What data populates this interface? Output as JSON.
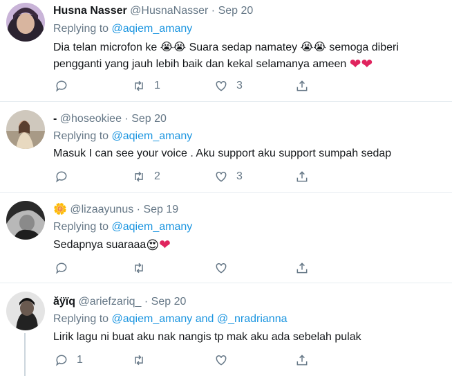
{
  "tweets": [
    {
      "name": "Husna Nasser",
      "handle": "@HusnaNasser",
      "date": "Sep 20",
      "reply_prefix": "Replying to",
      "reply_to": "@aqiem_amany",
      "text_line1": "Dia telan microfon ke 😭😭 Suara sedap namatey 😭😭 semoga diberi",
      "text_line2": "pengganti yang jauh lebih baik dan kekal selamanya ameen",
      "hearts": "❤❤",
      "replies": "",
      "retweets": "1",
      "likes": "3"
    },
    {
      "name": "-",
      "handle": "@hoseokiee",
      "date": "Sep 20",
      "reply_prefix": "Replying to",
      "reply_to": "@aqiem_amany",
      "text_line1": "Masuk I can see your voice . Aku support aku support sumpah sedap",
      "replies": "",
      "retweets": "2",
      "likes": "3"
    },
    {
      "name": "🌼",
      "handle": "@lizaayunus",
      "date": "Sep 19",
      "reply_prefix": "Replying to",
      "reply_to": "@aqiem_amany",
      "text_line1": "Sedapnya suaraaa",
      "emoji": "😍",
      "hearts": "❤",
      "replies": "",
      "retweets": "",
      "likes": ""
    },
    {
      "name": "ǎÿïq",
      "handle": "@ariefzariq_",
      "date": "Sep 20",
      "reply_prefix": "Replying to",
      "reply_to": "@aqiem_amany",
      "reply_and": "and",
      "reply_to2": "@_nradrianna",
      "text_line1": "Lirik lagu ni buat aku nak nangis tp mak aku ada sebelah pulak",
      "replies": "1",
      "retweets": "",
      "likes": ""
    }
  ],
  "separator": "·",
  "icons": [
    "reply-icon",
    "retweet-icon",
    "like-icon",
    "share-icon"
  ],
  "colors": {
    "link": "#1b95e0",
    "muted": "#657786",
    "heart": "#e0245e"
  }
}
